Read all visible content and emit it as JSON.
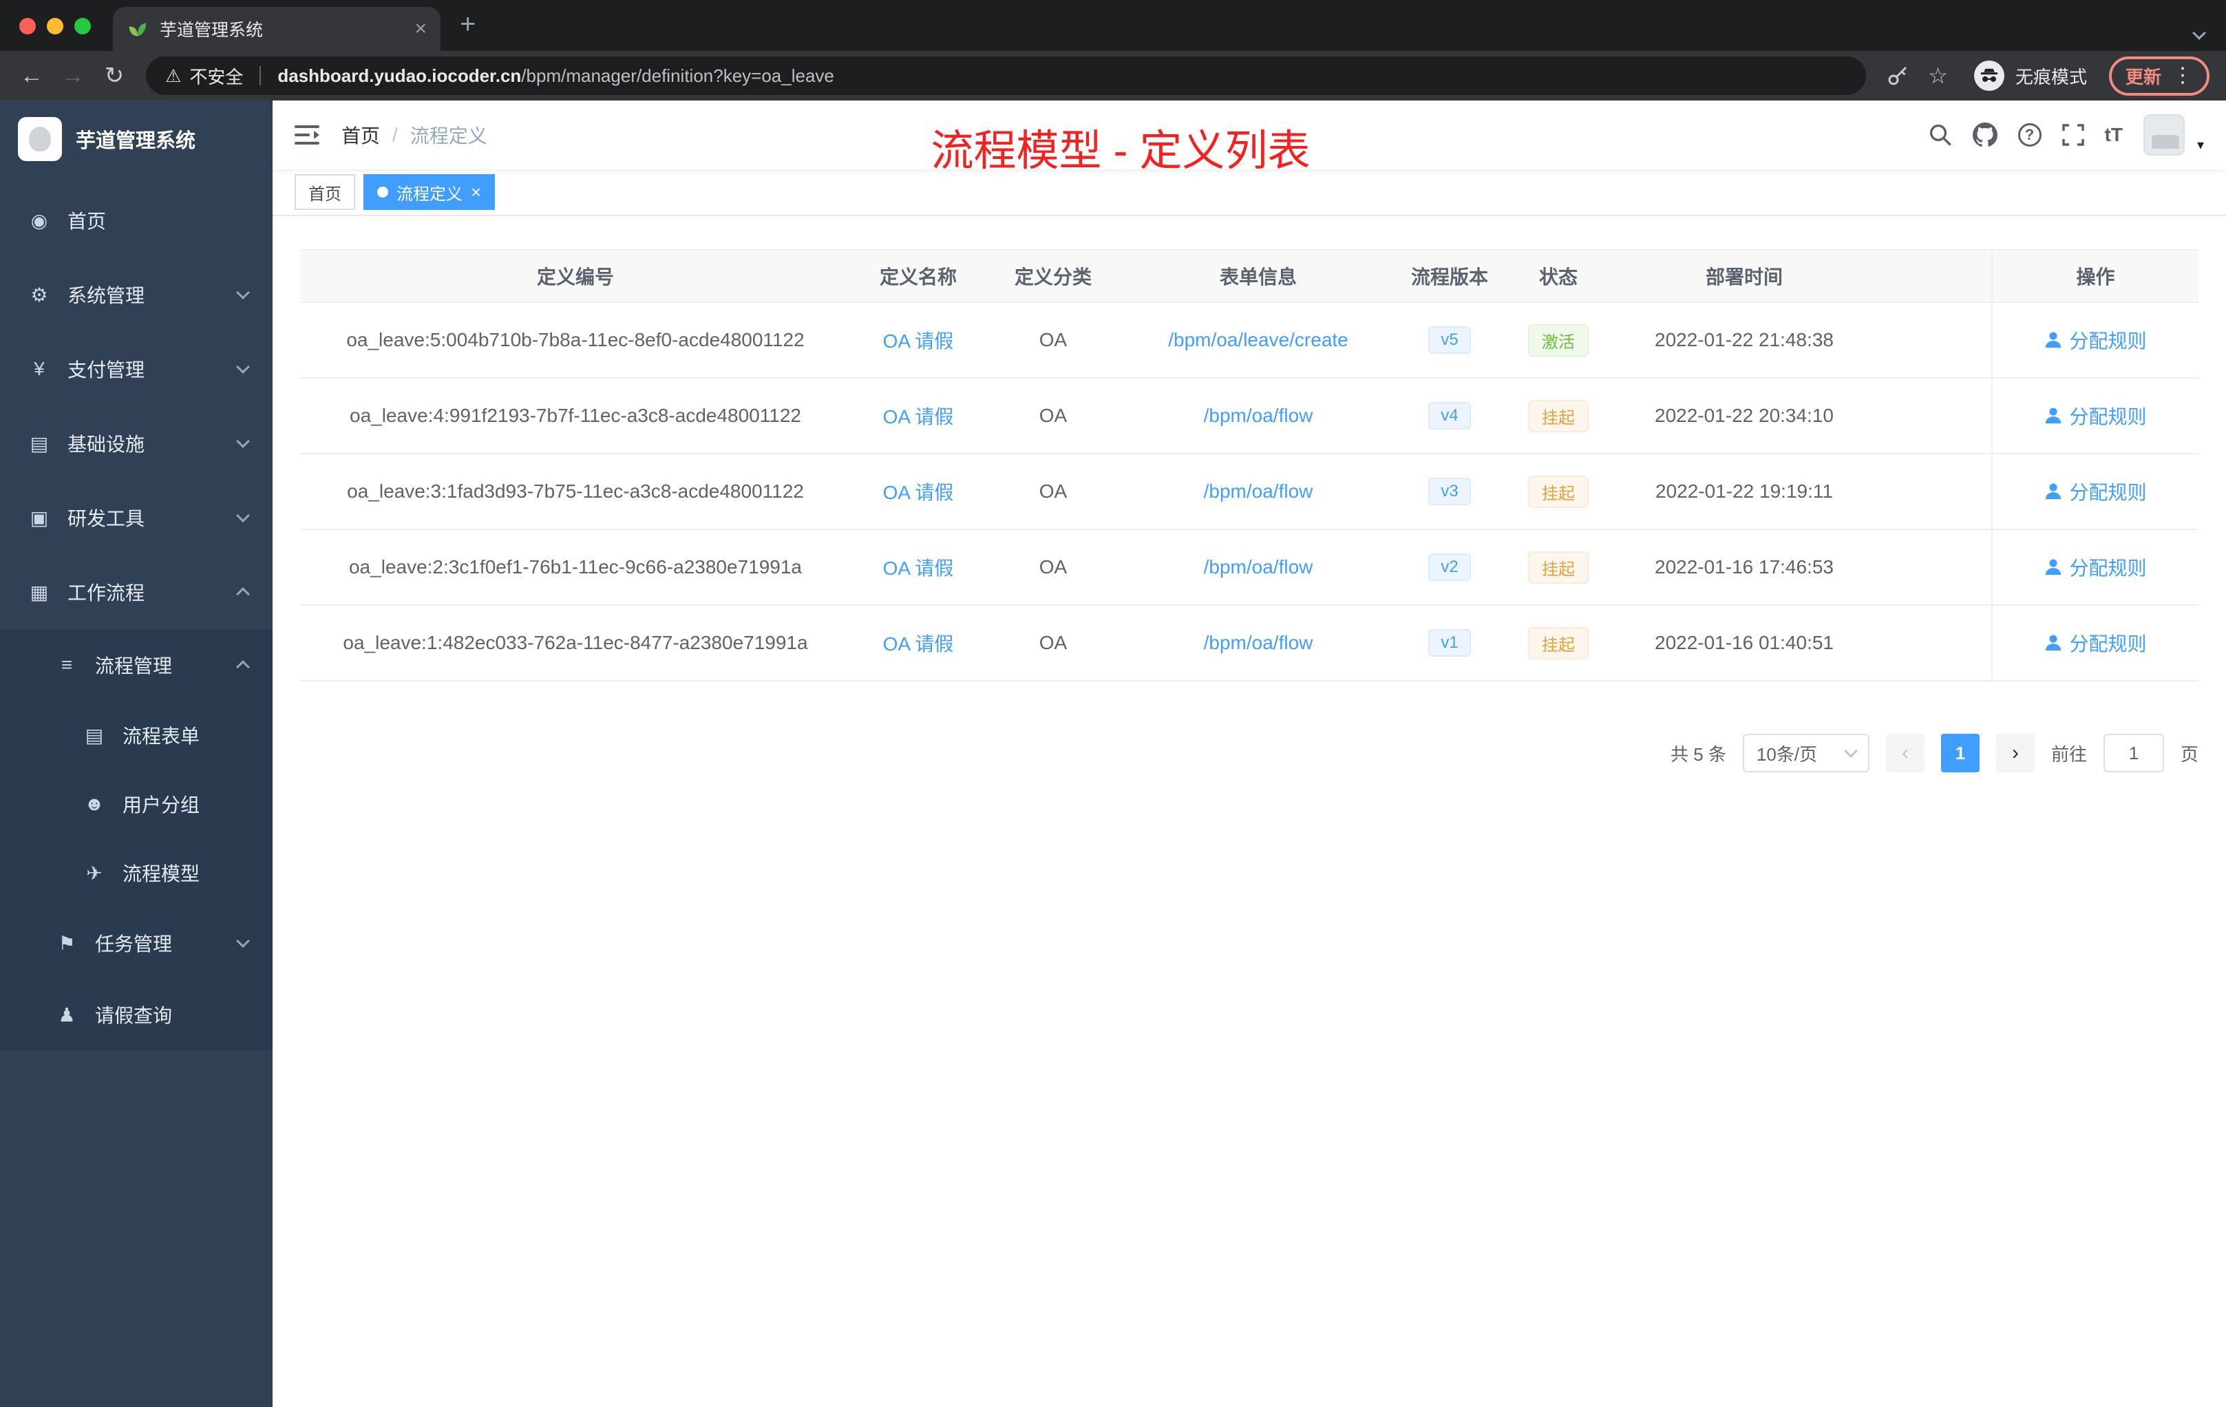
{
  "browser": {
    "tab_title": "芋道管理系统",
    "security_label": "不安全",
    "url_domain": "dashboard.yudao.iocoder.cn",
    "url_path": "/bpm/manager/definition?key=oa_leave",
    "incognito_label": "无痕模式",
    "update_label": "更新"
  },
  "icons": {
    "close-icon": "×",
    "new-tab-icon": "+",
    "back-icon": "←",
    "forward-icon": "→",
    "reload-icon": "↻",
    "warning-icon": "⚠",
    "star-icon": "☆",
    "kebab-icon": "⋮",
    "help-icon": "?",
    "font-size-icon": "tT",
    "caret-down-icon": "▾",
    "prev-icon": "‹",
    "next-icon": "›",
    "dashboard-icon": "◉",
    "gear-icon": "⚙",
    "payment-icon": "¥",
    "infrastructure-icon": "▤",
    "devtools-icon": "▣",
    "workflow-icon": "▦",
    "process-manage-icon": "≡",
    "form-icon": "▤",
    "user-group-icon": "☻",
    "model-icon": "✈",
    "task-icon": "⚑",
    "leave-query-icon": "♟"
  },
  "sidebar": {
    "logo_title": "芋道管理系统",
    "menu": [
      {
        "name": "home",
        "label": "首页",
        "icon": "dashboard-icon",
        "level": 1,
        "arrow": ""
      },
      {
        "name": "system",
        "label": "系统管理",
        "icon": "gear-icon",
        "level": 1,
        "arrow": "down"
      },
      {
        "name": "payment",
        "label": "支付管理",
        "icon": "payment-icon",
        "level": 1,
        "arrow": "down"
      },
      {
        "name": "infrastructure",
        "label": "基础设施",
        "icon": "infrastructure-icon",
        "level": 1,
        "arrow": "down"
      },
      {
        "name": "devtools",
        "label": "研发工具",
        "icon": "devtools-icon",
        "level": 1,
        "arrow": "down"
      },
      {
        "name": "workflow",
        "label": "工作流程",
        "icon": "workflow-icon",
        "level": 1,
        "arrow": "up"
      },
      {
        "name": "process-manage",
        "label": "流程管理",
        "icon": "process-manage-icon",
        "level": 2,
        "arrow": "up"
      },
      {
        "name": "process-form",
        "label": "流程表单",
        "icon": "form-icon",
        "level": 3,
        "arrow": ""
      },
      {
        "name": "user-group",
        "label": "用户分组",
        "icon": "user-group-icon",
        "level": 3,
        "arrow": ""
      },
      {
        "name": "process-model",
        "label": "流程模型",
        "icon": "model-icon",
        "level": 3,
        "arrow": ""
      },
      {
        "name": "task-manage",
        "label": "任务管理",
        "icon": "task-icon",
        "level": 2,
        "arrow": "down"
      },
      {
        "name": "leave-query",
        "label": "请假查询",
        "icon": "leave-query-icon",
        "level": 2,
        "arrow": ""
      }
    ]
  },
  "header": {
    "breadcrumb": [
      "首页",
      "流程定义"
    ],
    "annotation": "流程模型 - 定义列表"
  },
  "tags": [
    {
      "label": "首页",
      "active": false
    },
    {
      "label": "流程定义",
      "active": true
    }
  ],
  "table": {
    "columns": [
      "定义编号",
      "定义名称",
      "定义分类",
      "表单信息",
      "流程版本",
      "状态",
      "部署时间",
      "操作"
    ],
    "rows": [
      {
        "id": "oa_leave:5:004b710b-7b8a-11ec-8ef0-acde48001122",
        "name": "OA 请假",
        "category": "OA",
        "form": "/bpm/oa/leave/create",
        "version": "v5",
        "status": "激活",
        "status_type": "success",
        "deploy_time": "2022-01-22 21:48:38",
        "action": "分配规则"
      },
      {
        "id": "oa_leave:4:991f2193-7b7f-11ec-a3c8-acde48001122",
        "name": "OA 请假",
        "category": "OA",
        "form": "/bpm/oa/flow",
        "version": "v4",
        "status": "挂起",
        "status_type": "warning",
        "deploy_time": "2022-01-22 20:34:10",
        "action": "分配规则"
      },
      {
        "id": "oa_leave:3:1fad3d93-7b75-11ec-a3c8-acde48001122",
        "name": "OA 请假",
        "category": "OA",
        "form": "/bpm/oa/flow",
        "version": "v3",
        "status": "挂起",
        "status_type": "warning",
        "deploy_time": "2022-01-22 19:19:11",
        "action": "分配规则"
      },
      {
        "id": "oa_leave:2:3c1f0ef1-76b1-11ec-9c66-a2380e71991a",
        "name": "OA 请假",
        "category": "OA",
        "form": "/bpm/oa/flow",
        "version": "v2",
        "status": "挂起",
        "status_type": "warning",
        "deploy_time": "2022-01-16 17:46:53",
        "action": "分配规则"
      },
      {
        "id": "oa_leave:1:482ec033-762a-11ec-8477-a2380e71991a",
        "name": "OA 请假",
        "category": "OA",
        "form": "/bpm/oa/flow",
        "version": "v1",
        "status": "挂起",
        "status_type": "warning",
        "deploy_time": "2022-01-16 01:40:51",
        "action": "分配规则"
      }
    ]
  },
  "pagination": {
    "total": "共 5 条",
    "page_size": "10条/页",
    "current_page": "1",
    "goto_label": "前往",
    "goto_value": "1",
    "goto_unit": "页"
  },
  "colors": {
    "primary": "#409eff",
    "success": "#67c23a",
    "warning": "#e6a23c",
    "annotation_red": "#f52020",
    "sidebar_bg": "#304156",
    "sidebar_submenu_bg": "#2a3a4f",
    "table_header_bg": "#f8f8f9",
    "update_chip": "#f28b82"
  }
}
